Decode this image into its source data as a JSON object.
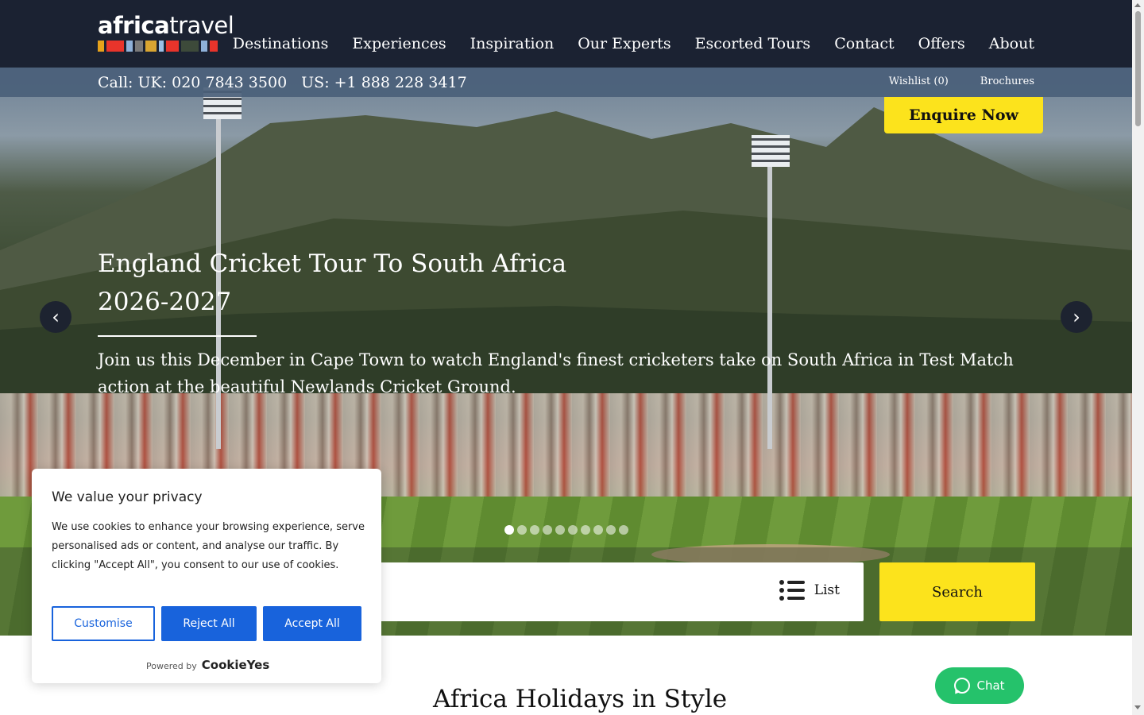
{
  "logo": {
    "bold": "africa",
    "light": "travel",
    "bar_colors": [
      "#e6a21b",
      "#e8342b",
      "#8fb1d9",
      "#7a7a7a",
      "#d9a531",
      "#9cc0e6",
      "#e8342b",
      "#3d4a3a",
      "#8fb1d9",
      "#e8342b"
    ]
  },
  "nav": {
    "items": [
      "Destinations",
      "Experiences",
      "Inspiration",
      "Our Experts",
      "Escorted Tours",
      "Contact",
      "Offers",
      "About"
    ]
  },
  "subbar": {
    "phone_uk": "Call: UK: 020 7843 3500",
    "phone_us": "US: +1 888 228 3417",
    "wishlist": "Wishlist (0)",
    "brochures": "Brochures"
  },
  "hero": {
    "enquire_label": "Enquire Now",
    "title": "England Cricket Tour To South Africa 2026-2027",
    "text": "Join us this December in Cape Town to watch England's finest cricketers take on South Africa in Test Match action at the beautiful Newlands Cricket Ground.",
    "prev_icon": "chevron-left-icon",
    "next_icon": "chevron-right-icon",
    "slide_count": 10,
    "active_slide": 1
  },
  "search": {
    "list_label": "List",
    "button_label": "Search"
  },
  "section": {
    "heading": "Africa Holidays in Style"
  },
  "chat": {
    "label": "Chat"
  },
  "cookie": {
    "title": "We value your privacy",
    "text": "We use cookies to enhance your browsing experience, serve personalised ads or content, and analyse our traffic. By clicking \"Accept All\", you consent to our use of cookies.",
    "customise": "Customise",
    "reject": "Reject All",
    "accept": "Accept All",
    "powered_by": "Powered by",
    "brand": "CookieYes"
  },
  "colors": {
    "accent_yellow": "#fce31c",
    "header_navy": "#1b2232",
    "cookie_blue": "#1863dc",
    "chat_green": "#25c26b"
  }
}
